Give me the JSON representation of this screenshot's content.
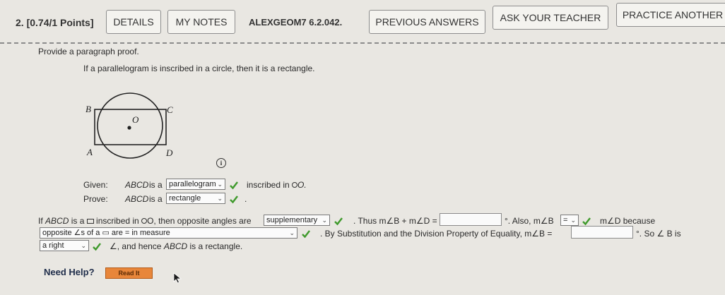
{
  "header": {
    "question_label": "2. [0.74/1 Points]",
    "details": "DETAILS",
    "my_notes": "MY NOTES",
    "question_id": "ALEXGEOM7 6.2.042.",
    "previous_answers": "PREVIOUS ANSWERS",
    "ask_teacher": "ASK YOUR TEACHER",
    "practice_another": "PRACTICE ANOTHER"
  },
  "problem": {
    "instruction": "Provide a paragraph proof.",
    "statement": "If a parallelogram is inscribed in a circle, then it is a rectangle."
  },
  "figure": {
    "labels": {
      "B": "B",
      "C": "C",
      "A": "A",
      "D": "D",
      "O": "O"
    }
  },
  "info_icon": "i",
  "given": {
    "label": "Given:",
    "subject": "ABCD",
    "is_a": "is a",
    "dropdown_value": "parallelogram",
    "tail": "inscribed in ",
    "circle_name": "O."
  },
  "prove": {
    "label": "Prove:",
    "subject": "ABCD",
    "is_a": "is a",
    "dropdown_value": "rectangle",
    "tail": "."
  },
  "proof": {
    "line1_prefix": "If ",
    "line1_subject": "ABCD",
    "line1_is_a": " is a ",
    "line1_mid": " inscribed in ",
    "line1_o": "O, then opposite angles are",
    "dropdown_supplementary": "supplementary",
    "thus_text": ". Thus m∠B + m∠D =",
    "also_text": "°. Also, m∠B",
    "eq_dropdown": "=",
    "mD_because": "m∠D because",
    "dropdown_opposite": "opposite ∠s of a ▭ are = in measure",
    "substitution_text": ". By Substitution and the Division Property of Equality, m∠B =",
    "so_text": "°. So ∠ B is",
    "dropdown_right": "a right",
    "conclusion_prefix": "∠, and hence ",
    "conclusion_subject": "ABCD",
    "conclusion_suffix": " is a rectangle."
  },
  "help": {
    "label": "Need Help?",
    "read_it": "Read It"
  },
  "colors": {
    "check": "#3f9a2c",
    "read_button": "#e8863a",
    "background": "#e9e7e2"
  }
}
